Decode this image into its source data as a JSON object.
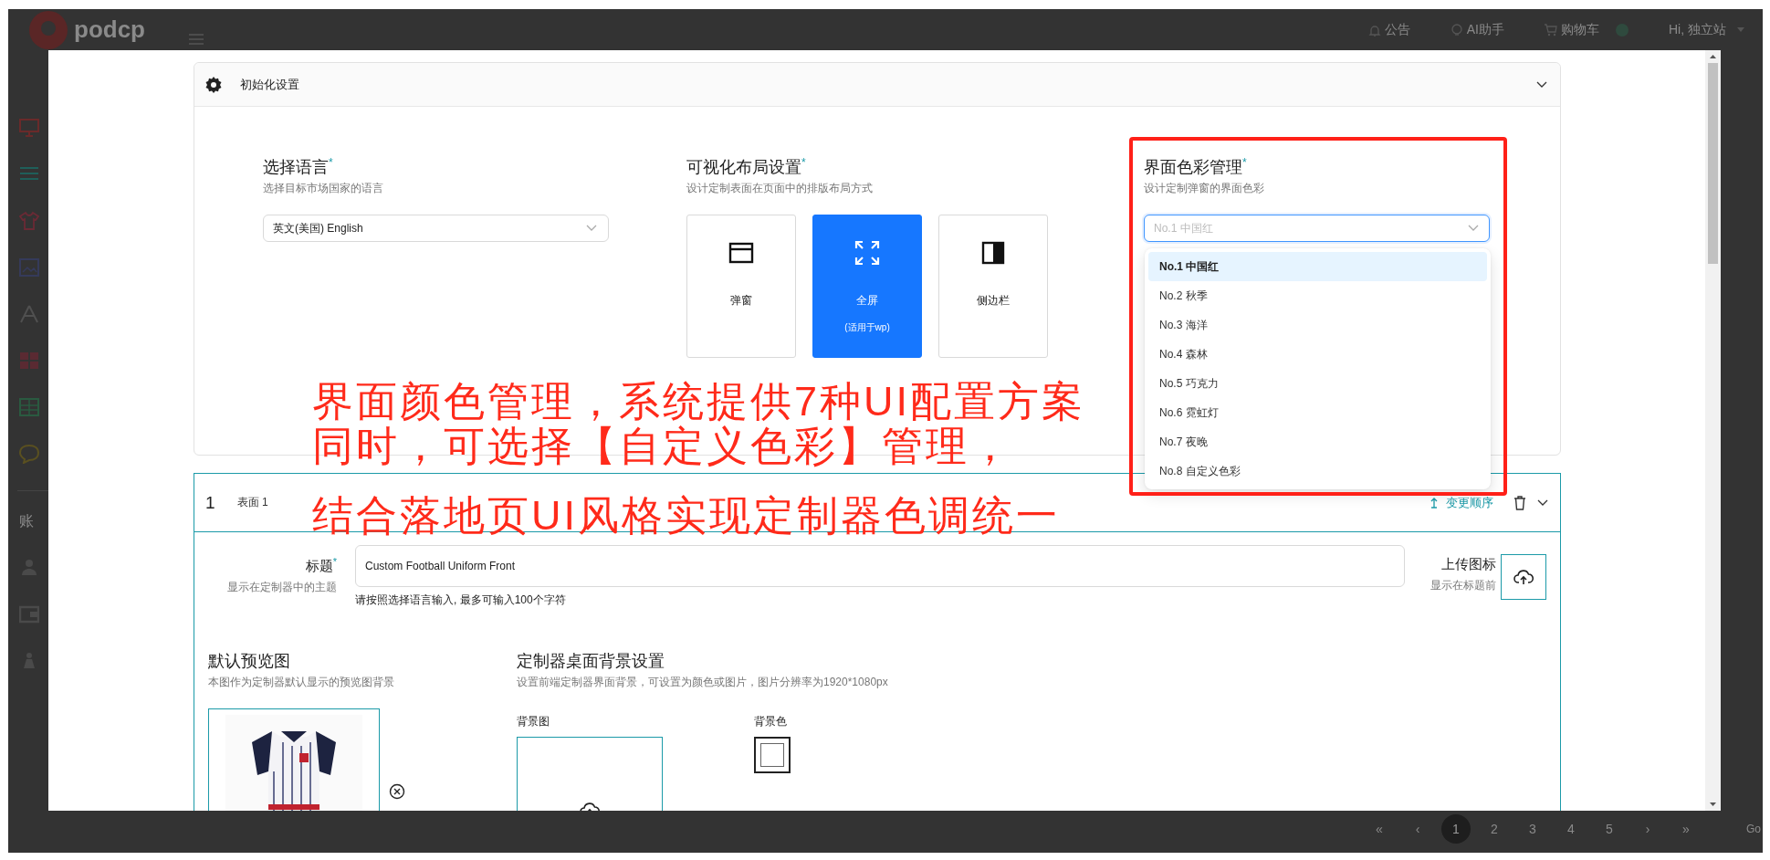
{
  "app_header": {
    "logo": "podcp",
    "links": [
      {
        "label": "公告"
      },
      {
        "label": "AI助手"
      },
      {
        "label": "购物车"
      }
    ],
    "user_menu": "Hi, 独立站"
  },
  "sidebar": {
    "section_label": "账"
  },
  "modal": {
    "init_panel": {
      "title": "初始化设置"
    },
    "language": {
      "label": "选择语言$^{*}$",
      "hint": "选择目标市场国家的语言",
      "value": "英文(美国) English"
    },
    "layout": {
      "label": "可视化布局设置$^{*}$",
      "hint": "设计定制表面在页面中的排版布局方式",
      "options": [
        {
          "label": "弹窗",
          "selected": false
        },
        {
          "label": "全屏",
          "sublabel": "(适用于wp)",
          "selected": true
        },
        {
          "label": "侧边栏",
          "selected": false
        }
      ]
    },
    "color_scheme": {
      "label": "界面色彩管理$^{*}$",
      "hint": "设计定制弹窗的界面色彩",
      "placeholder": "No.1 中国红",
      "expanded": true,
      "options": [
        {
          "label": "No.1 中国红",
          "selected": true
        },
        {
          "label": "No.2 秋季",
          "selected": false
        },
        {
          "label": "No.3 海洋",
          "selected": false
        },
        {
          "label": "No.4 森林",
          "selected": false
        },
        {
          "label": "No.5 巧克力",
          "selected": false
        },
        {
          "label": "No.6 霓虹灯",
          "selected": false
        },
        {
          "label": "No.7 夜晚",
          "selected": false
        },
        {
          "label": "No.8 自定义色彩",
          "selected": false
        }
      ]
    },
    "surface": {
      "index": "1",
      "name": "表面 1",
      "reorder_link": "变更顺序",
      "title_field": {
        "label": "标题$^{*}$",
        "hint": "显示在定制器中的主题",
        "value": "Custom Football Uniform Front",
        "help": "请按照选择语言输入, 最多可输入100个字符"
      },
      "icon_upload": {
        "label": "上传图标",
        "hint": "显示在标题前"
      },
      "preview": {
        "label": "默认预览图",
        "hint": "本图作为定制器默认显示的预览图背景"
      },
      "background": {
        "label": "定制器桌面背景设置",
        "hint": "设置前端定制器界面背景，可设置为颜色或图片，图片分辨率为1920*1080px",
        "image_label": "背景图",
        "color_label": "背景色"
      }
    }
  },
  "annotation": {
    "lines": [
      "界面颜色管理，系统提供7种UI配置方案",
      "同时，可选择【自定义色彩】管理，",
      "结合落地页UI风格实现定制器色调统一"
    ]
  },
  "pagination": {
    "pages": [
      {
        "label": "«",
        "selected": false
      },
      {
        "label": "‹",
        "selected": false
      },
      {
        "label": "1",
        "selected": true
      },
      {
        "label": "2",
        "selected": false
      },
      {
        "label": "3",
        "selected": false
      },
      {
        "label": "4",
        "selected": false
      },
      {
        "label": "5",
        "selected": false
      },
      {
        "label": "›",
        "selected": false
      },
      {
        "label": "»",
        "selected": false
      }
    ],
    "go": "Go"
  }
}
